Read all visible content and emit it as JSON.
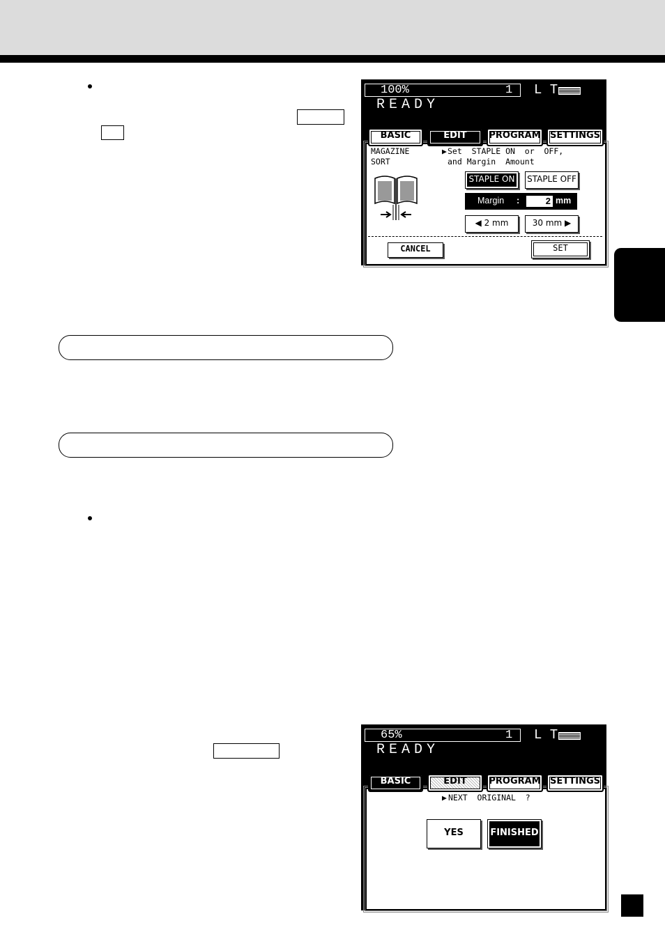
{
  "panel1": {
    "zoom": "100%",
    "count": "1",
    "paper": "L T",
    "status": "READY",
    "tabs": [
      "BASIC",
      "EDIT",
      "PROGRAM",
      "SETTINGS"
    ],
    "mode_line1": "MAGAZINE",
    "mode_line2": "SORT",
    "instruction_line1": "Set  STAPLE ON  or  OFF,",
    "instruction_line2": "and Margin  Amount",
    "staple_on": "STAPLE  ON",
    "staple_off": "STAPLE OFF",
    "margin_label": "Margin",
    "margin_sep": ":",
    "margin_value": "2",
    "margin_unit": "mm",
    "dec_label": "2 mm",
    "inc_label": "30 mm",
    "cancel": "CANCEL",
    "set": "SET"
  },
  "panel2": {
    "zoom": "65%",
    "count": "1",
    "paper": "L T",
    "status": "READY",
    "tabs": [
      "BASIC",
      "EDIT",
      "PROGRAM",
      "SETTINGS"
    ],
    "prompt": "NEXT  ORIGINAL  ?",
    "yes": "YES",
    "finished": "FINISHED"
  },
  "colors": {
    "header_band": "#dcdcdc",
    "ink": "#000000"
  }
}
